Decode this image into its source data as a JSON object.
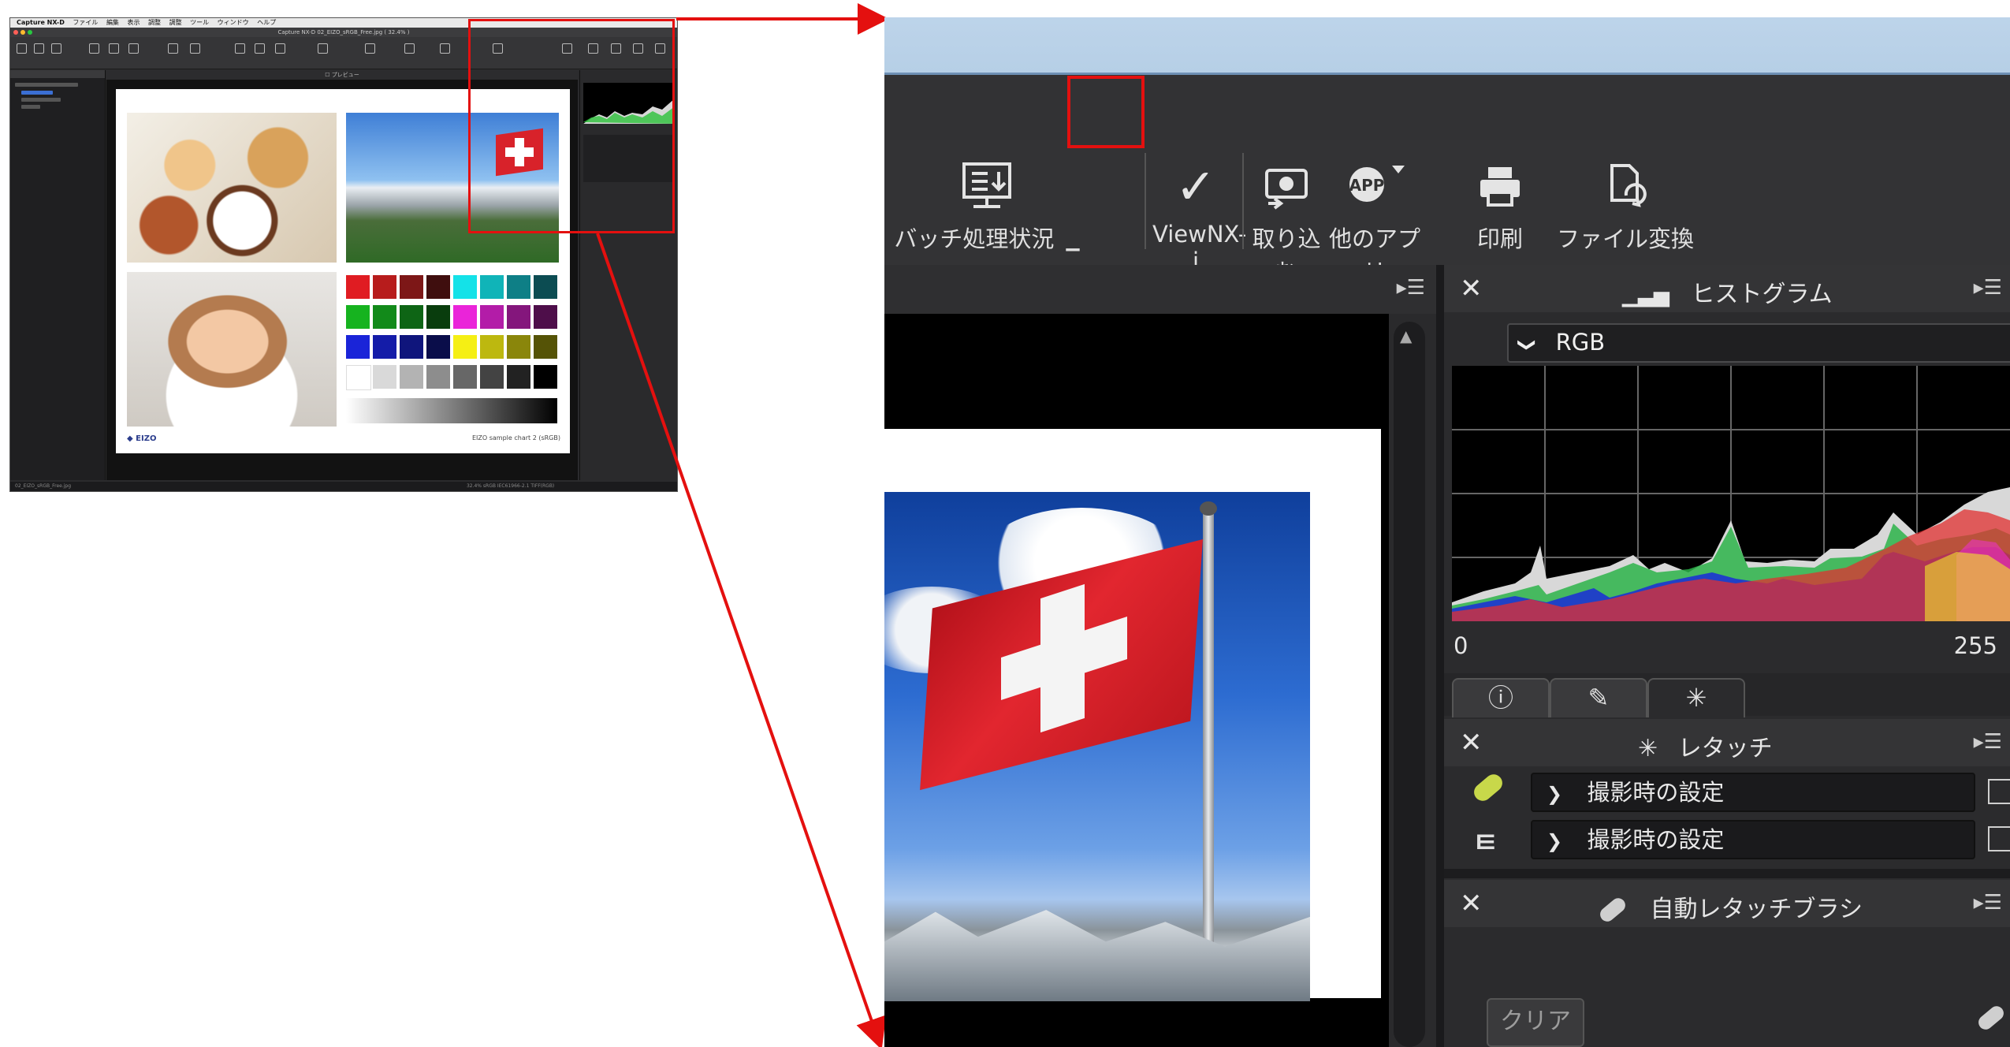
{
  "app": {
    "menu": [
      "Capture NX-D",
      "ファイル",
      "編集",
      "表示",
      "調整",
      "調整",
      "ツール",
      "ウィンドウ",
      "ヘルプ"
    ],
    "window_title": "Capture NX-D   02_EIZO_sRGB_Free.jpg ( 32.4% )",
    "status_left": "02_EIZO_sRGB_Free.jpg",
    "status_right": "32.4%   sRGB IEC61966-2.1   TIFF(RGB)"
  },
  "chart_caption": "EIZO sample chart 2  (sRGB)",
  "logo_text": "EIZO",
  "colors": {
    "callout": "#e4100f",
    "toolbar": "#333335",
    "panel": "#2b2b2d"
  },
  "toolbar": {
    "batch_label": "バッチ処理状況",
    "viewnx_label": "ViewNX-i",
    "import_label": "取り込む",
    "other_app_label": "他のアプリ",
    "print_label": "印刷",
    "convert_label": "ファイル変換"
  },
  "histogram": {
    "title": "ヒストグラム",
    "channel": "RGB",
    "min_label": "0",
    "max_label": "255"
  },
  "retouch": {
    "title": "レタッチ",
    "rows": [
      {
        "value": "撮影時の設定",
        "icon": "bandage-icon"
      },
      {
        "value": "撮影時の設定",
        "icon": "tree-icon"
      }
    ]
  },
  "auto_brush": {
    "title": "自動レタッチブラシ",
    "clear_label": "クリア"
  },
  "icons": {
    "close": "✕",
    "menu": "▸☰",
    "chevron": "❯",
    "info_tab": "ⓘ",
    "edit_tab": "✎",
    "wand_tab": "✳"
  }
}
